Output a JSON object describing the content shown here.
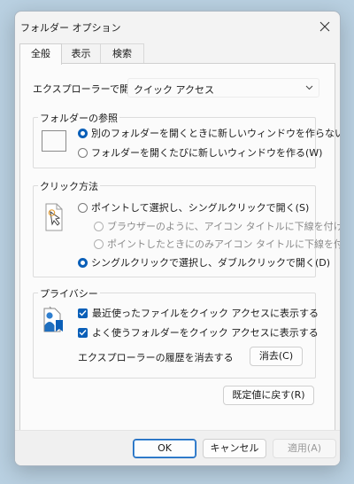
{
  "window": {
    "title": "フォルダー オプション"
  },
  "tabs": [
    {
      "label": "全般",
      "active": true
    },
    {
      "label": "表示",
      "active": false
    },
    {
      "label": "検索",
      "active": false
    }
  ],
  "explorer_open": {
    "label": "エクスプローラーで開く:",
    "value": "クイック アクセス"
  },
  "browse_folders": {
    "title": "フォルダーの参照",
    "options": [
      {
        "label": "別のフォルダーを開くときに新しいウィンドウを作らない(M)",
        "selected": true
      },
      {
        "label": "フォルダーを開くたびに新しいウィンドウを作る(W)",
        "selected": false
      }
    ]
  },
  "click_method": {
    "title": "クリック方法",
    "single_click": "ポイントして選択し、シングルクリックで開く(S)",
    "underline_browser": "ブラウザーのように、アイコン タイトルに下線を付ける(B)",
    "underline_hover": "ポイントしたときにのみアイコン タイトルに下線を付ける(",
    "double_click": "シングルクリックで選択し、ダブルクリックで開く(D)"
  },
  "privacy": {
    "title": "プライバシー",
    "recent_files": "最近使ったファイルをクイック アクセスに表示する",
    "frequent_folders": "よく使うフォルダーをクイック アクセスに表示する",
    "clear_history_label": "エクスプローラーの履歴を消去する",
    "clear_button": "消去(C)"
  },
  "restore_defaults": "既定値に戻す(R)",
  "footer": {
    "ok": "OK",
    "cancel": "キャンセル",
    "apply": "適用(A)"
  },
  "colors": {
    "accent": "#0a5fb8",
    "background": "#b9d0e1"
  }
}
